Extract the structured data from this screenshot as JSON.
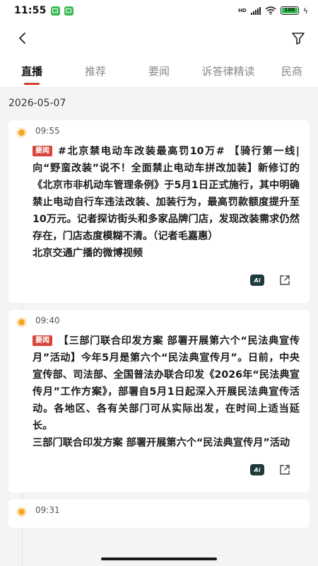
{
  "status_bar": {
    "time": "11:55",
    "network_type": "HD",
    "battery_level": "100"
  },
  "nav": {
    "back_icon": "chevron-left-icon",
    "filter_icon": "filter-icon"
  },
  "tabs": [
    {
      "label": "直播",
      "active": true
    },
    {
      "label": "推荐",
      "active": false
    },
    {
      "label": "要闻",
      "active": false
    },
    {
      "label": "诉答律精读",
      "active": false
    },
    {
      "label": "民商",
      "active": false
    }
  ],
  "feed": {
    "date": "2026-05-07",
    "items": [
      {
        "time": "09:55",
        "badge": "要闻",
        "text": "#北京禁电动车改装最高罚10万# 【骑行第一线|向“野蛮改装”说不！全面禁止电动车拼改加装】新修订的《北京市非机动车管理条例》于5月1日正式施行，其中明确禁止电动自行车违法改装、加装行为，最高罚款额度提升至10万元。记者探访街头和多家品牌门店，发现改装需求仍然存在，门店态度模糊不清。（记者毛嘉惠）",
        "source": "北京交通广播的微博视频",
        "ai_label": "Ai"
      },
      {
        "time": "09:40",
        "badge": "要闻",
        "text": "【三部门联合印发方案 部署开展第六个“民法典宣传月”活动】今年5月是第六个“民法典宣传月”。日前，中央宣传部、司法部、全国普法办联合印发《2026年“民法典宣传月”工作方案》，部署自5月1日起深入开展民法典宣传活动。各地区、各有关部门可从实际出发，在时间上适当延长。",
        "source": "三部门联合印发方案 部署开展第六个“民法典宣传月”活动",
        "ai_label": "Ai"
      },
      {
        "time": "09:31"
      }
    ]
  },
  "colors": {
    "accent": "#d23b2f",
    "badge": "#d8453a",
    "timeline_dot": "#f5a623",
    "ai_button": "#1f3a3a"
  }
}
